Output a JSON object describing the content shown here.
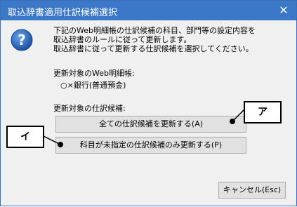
{
  "window": {
    "title": "取込辞書適用仕訳候補選択",
    "close_label": "✕"
  },
  "message": {
    "line1": "下記のWeb明細帳の仕訳候補の科目、部門等の設定内容を",
    "line2": "取込辞書のルールに従って更新します。",
    "line3": "取込辞書に従って更新する仕訳候補を選択してください。"
  },
  "target_ledger": {
    "label": "更新対象のWeb明細帳:",
    "value": "○×銀行(普通預金)"
  },
  "target_candidates": {
    "label": "更新対象の仕訳候補:"
  },
  "buttons": {
    "update_all": "全ての仕訳候補を更新する(A)",
    "update_unassigned": "科目が未指定の仕訳候補のみ更新する(P)",
    "cancel": "キャンセル(Esc)"
  },
  "callouts": {
    "a": "ア",
    "i": "イ"
  },
  "icons": {
    "question": "question-icon"
  }
}
